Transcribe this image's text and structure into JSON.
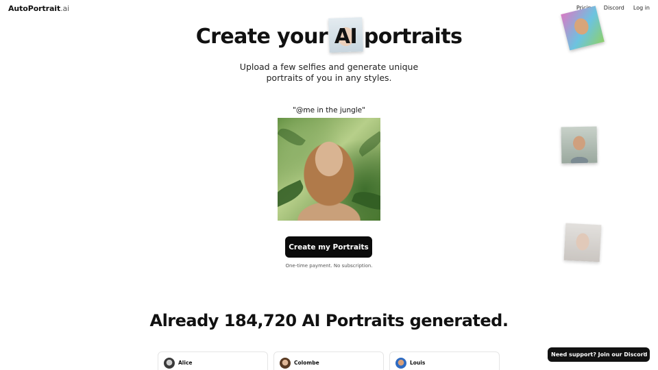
{
  "nav": {
    "logo_main": "AutoPortrait",
    "logo_suffix": ".ai",
    "links": [
      "Pricing",
      "Discord",
      "Log in"
    ]
  },
  "hero": {
    "title": "Create your AI portraits",
    "subtitle_line1": "Upload a few selfies and generate unique",
    "subtitle_line2": "portraits of you in any styles.",
    "prompt_caption": "\"@me in the jungle\"",
    "cta_label": "Create my Portraits",
    "payment_note": "One-time payment. No subscription."
  },
  "stats": {
    "headline": "Already 184,720 AI Portraits generated."
  },
  "testimonials": [
    {
      "name": "Alice"
    },
    {
      "name": "Colombe"
    },
    {
      "name": "Louis"
    }
  ],
  "support": {
    "label": "Need support? Join our Discord",
    "icon": "chevron-right-icon"
  },
  "colors": {
    "primary": "#0b0b0b",
    "background": "#ffffff",
    "text": "#111111"
  }
}
